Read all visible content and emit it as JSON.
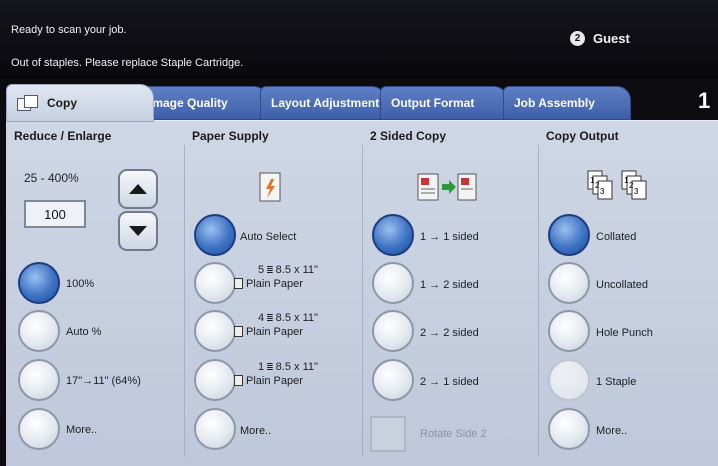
{
  "status": {
    "message1": "Ready to scan your job.",
    "message2": "Out of staples. Please replace Staple Cartridge.",
    "user_label": "Guest",
    "user_icon": "2"
  },
  "tabs": [
    {
      "label": "Copy"
    },
    {
      "label": "Image Quality"
    },
    {
      "label": "Layout Adjustment"
    },
    {
      "label": "Output Format"
    },
    {
      "label": "Job Assembly"
    }
  ],
  "tab_page_number": "1",
  "reduce_enlarge": {
    "heading": "Reduce / Enlarge",
    "range": "25 - 400%",
    "value": "100",
    "options": [
      "100%",
      "Auto %",
      "17\"→11\" (64%)",
      "More.."
    ],
    "selected": "100%"
  },
  "paper_supply": {
    "heading": "Paper Supply",
    "options": [
      {
        "line1": "Auto Select",
        "line2": ""
      },
      {
        "tray": "5",
        "line1": "8.5 x 11\"",
        "line2": "Plain Paper"
      },
      {
        "tray": "4",
        "line1": "8.5 x 11\"",
        "line2": "Plain Paper"
      },
      {
        "tray": "1",
        "line1": "8.5 x 11\"",
        "line2": "Plain Paper"
      },
      {
        "line1": "More..",
        "line2": ""
      }
    ],
    "selected": "Auto Select"
  },
  "two_sided": {
    "heading": "2 Sided Copy",
    "options": [
      "1 → 1 sided",
      "1 → 2 sided",
      "2 → 2 sided",
      "2 → 1 sided"
    ],
    "rotate_label": "Rotate Side 2",
    "selected": "1 → 1 sided"
  },
  "copy_output": {
    "heading": "Copy Output",
    "options": [
      "Collated",
      "Uncollated",
      "Hole Punch",
      "1 Staple",
      "More.."
    ],
    "selected": "Collated",
    "disabled": "1 Staple"
  },
  "colors": {
    "selected_radio": "#3e72c2",
    "tab_blue": "#4b6cb5",
    "panel_bg": "#c7cfdf"
  }
}
